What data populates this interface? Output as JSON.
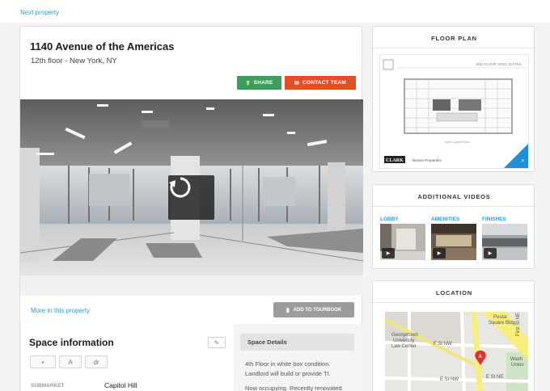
{
  "nav": {
    "next_property": "Next property"
  },
  "property": {
    "title": "1140 Avenue of the Americas",
    "subtitle": "12th floor - New York, NY",
    "share_label": "SHARE",
    "contact_label": "CONTACT TEAM",
    "more_link": "More in this property",
    "tourbook_label": "ADD TO TOURBOOK"
  },
  "space_info": {
    "title": "Space information",
    "tags": [
      "A",
      "dr"
    ],
    "submarket_key": "SUBMARKET",
    "submarket_value": "Capitol Hill"
  },
  "space_details": {
    "title": "Space Details",
    "text1": "4th Floor in white box condition. Landlord will build or provide TI.",
    "text2": "Now occupying. Recently renovated"
  },
  "floor_plan": {
    "title": "FLOOR PLAN",
    "header_text": "3RD FLOOR SPEC SUITES",
    "brand1": "CLARK",
    "brand2": "Boston Properties",
    "footer_text": "North Capitol Street"
  },
  "videos": {
    "title": "ADDITIONAL VIDEOS",
    "items": [
      {
        "label": "LOBBY"
      },
      {
        "label": "AMENITIES"
      },
      {
        "label": "FINISHES"
      }
    ]
  },
  "location": {
    "title": "LOCATION",
    "map_labels": {
      "postal": "Postal",
      "square": "Square Bldg",
      "f_st": "F St NW",
      "georgetown1": "Georgetown",
      "georgetown2": "University",
      "georgetown3": "Law Center",
      "f_st2": "F St NW",
      "e_st": "E St NW",
      "e_st2": "E St NE",
      "first_st": "First St NE",
      "union1": "Wash",
      "union2": "Union"
    }
  },
  "colors": {
    "link": "#2a9bd6",
    "share": "#3f9c5a",
    "contact": "#e34f25",
    "tourbook": "#9c9c9c",
    "map_marker": "#e0332c"
  }
}
